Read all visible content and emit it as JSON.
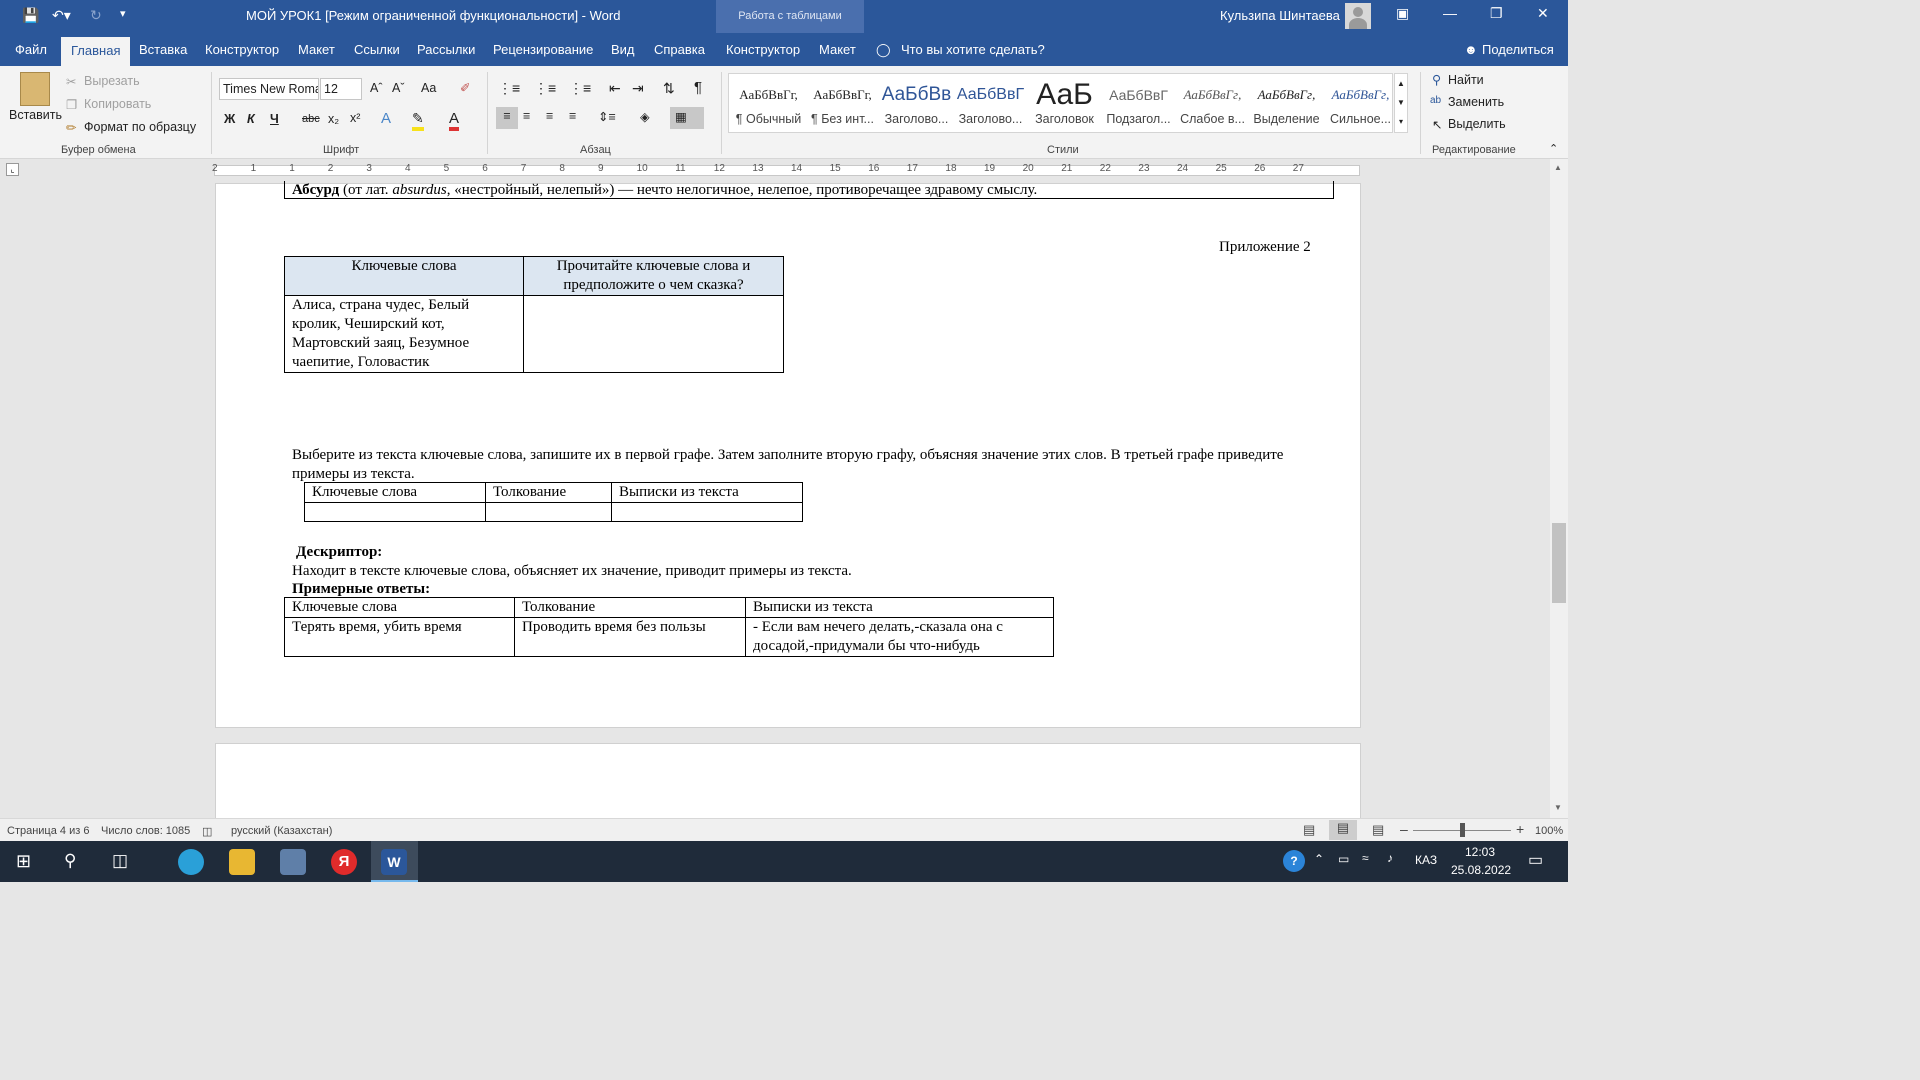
{
  "window": {
    "title": "МОЙ УРОК1 [Режим ограниченной функциональности]  -  Word",
    "context_tab_group": "Работа с таблицами",
    "user": "Кульзипа Шинтаева"
  },
  "menu": {
    "tabs": [
      "Файл",
      "Главная",
      "Вставка",
      "Конструктор",
      "Макет",
      "Ссылки",
      "Рассылки",
      "Рецензирование",
      "Вид",
      "Справка",
      "Конструктор",
      "Макет"
    ],
    "active_tab": "Главная",
    "tell_me": "Что вы хотите сделать?",
    "share": "Поделиться"
  },
  "ribbon": {
    "clipboard": {
      "paste": "Вставить",
      "cut": "Вырезать",
      "copy": "Копировать",
      "format_painter": "Формат по образцу",
      "group": "Буфер обмена"
    },
    "font": {
      "name": "Times New Roman",
      "size": "12",
      "group": "Шрифт",
      "bold": "Ж",
      "italic": "К",
      "underline": "Ч",
      "strike": "abc",
      "case": "Aa"
    },
    "paragraph": {
      "group": "Абзац"
    },
    "styles": {
      "group": "Стили",
      "items": [
        {
          "preview": "АаБбВвГг,",
          "name": "¶ Обычный"
        },
        {
          "preview": "АаБбВвГг,",
          "name": "¶ Без инт..."
        },
        {
          "preview": "АаБбВв",
          "name": "Заголово..."
        },
        {
          "preview": "АаБбВвГ",
          "name": "Заголово..."
        },
        {
          "preview": "АаБ",
          "name": "Заголовок"
        },
        {
          "preview": "АаБбВвГ",
          "name": "Подзагол..."
        },
        {
          "preview": "АаБбВвГг,",
          "name": "Слабое в..."
        },
        {
          "preview": "АаБбВвГг,",
          "name": "Выделение"
        },
        {
          "preview": "АаБбВвГг,",
          "name": "Сильное..."
        }
      ]
    },
    "editing": {
      "find": "Найти",
      "replace": "Заменить",
      "select": "Выделить",
      "group": "Редактирование"
    }
  },
  "ruler": {
    "ticks": [
      "2",
      "1",
      "1",
      "2",
      "3",
      "4",
      "5",
      "6",
      "7",
      "8",
      "9",
      "10",
      "11",
      "12",
      "13",
      "14",
      "15",
      "16",
      "17",
      "18",
      "19",
      "20",
      "21",
      "22",
      "23",
      "24",
      "25",
      "26",
      "27"
    ]
  },
  "document": {
    "absurd_line": {
      "term": "Абсурд",
      "p1": " (от лат. ",
      "latin": "absurdus",
      "p2": ", «нестройный, нелепый») — нечто нелогичное, нелепое, противоречащее здравому смыслу."
    },
    "appendix": "Приложение 2",
    "table1": {
      "headers": [
        "Ключевые слова",
        "Прочитайте ключевые слова и предположите о чем сказка?"
      ],
      "cell": "Алиса, страна чудес, Белый кролик, Чеширский кот, Мартовский заяц, Безумное чаепитие, Головастик",
      "cell2": ""
    },
    "instruction": "Выберите из текста ключевые слова, запишите их в первой графе. Затем заполните вторую графу, объясняя значение этих слов. В третьей графе приведите примеры из текста.",
    "table2": {
      "headers": [
        "Ключевые слова",
        "Толкование",
        "Выписки из текста"
      ]
    },
    "descriptor_label": "Дескриптор:",
    "descriptor_text": "Находит в тексте ключевые слова, объясняет их значение, приводит примеры из текста.",
    "answers_label": "Примерные ответы:",
    "table3": {
      "headers": [
        "Ключевые слова",
        "Толкование",
        "Выписки из текста"
      ],
      "row": [
        "Терять время, убить время",
        "Проводить время без пользы",
        "- Если вам нечего делать,-сказала она с досадой,-придумали бы что-нибудь"
      ]
    }
  },
  "status": {
    "page": "Страница 4 из 6",
    "words": "Число слов: 1085",
    "lang": "русский (Казахстан)",
    "zoom": "100%"
  },
  "taskbar": {
    "keyboard": "КАЗ",
    "time": "12:03",
    "date": "25.08.2022"
  }
}
